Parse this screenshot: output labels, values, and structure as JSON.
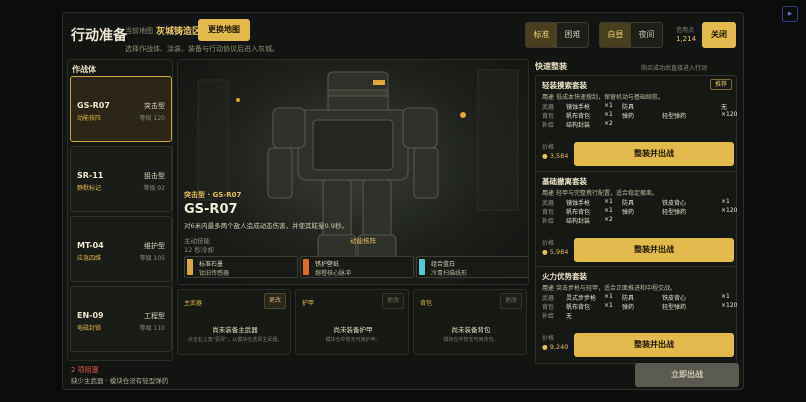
{
  "header": {
    "title": "行动准备",
    "map_label": "当前地图",
    "map_name": "灰城铸造区",
    "change_map": "更换地图",
    "subtitle": "选择作战体、涂装、装备与行动协议后进入灰城。",
    "difficulty": [
      "标准",
      "困难"
    ],
    "time": [
      "白昼",
      "夜间"
    ],
    "credit_label": "信用点",
    "credit_value": "1,214",
    "close": "关闭"
  },
  "left": {
    "title": "作战体",
    "mechs": [
      {
        "id": "GS-R07",
        "role": "突击型",
        "sub": "动能核阵",
        "level": "等级 120"
      },
      {
        "id": "SR-11",
        "role": "狙击型",
        "sub": "静默标记",
        "level": "等级 92"
      },
      {
        "id": "MT-04",
        "role": "维护型",
        "sub": "应急四维",
        "level": "等级 105"
      },
      {
        "id": "EN-09",
        "role": "工程型",
        "sub": "电磁封锁",
        "level": "等级 110"
      }
    ]
  },
  "hero": {
    "tag": "突击型 · GS-R07",
    "id": "GS-R07",
    "desc": "对6米内最多两个敌人造成动态伤害，并使其眩晕0.9秒。",
    "skill_label": "主动技能",
    "skill_cd": "12 秒冷却",
    "skill_name": "动能核阵",
    "mods": [
      {
        "title": "标准石墨",
        "sub": "钛旧传感器",
        "color": "#d6a84a"
      },
      {
        "title": "锈护壁纸",
        "sub": "熔橙核心脉冲",
        "color": "#e06a2a"
      },
      {
        "title": "组合蓝白",
        "sub": "冷青扫描线形",
        "color": "#59c7cf"
      }
    ]
  },
  "slots": [
    {
      "label": "主武器",
      "change": "更改",
      "name": "尚未装备主武器",
      "hint": "点击右上角\"更改\"，从模块仓选择主武器。"
    },
    {
      "label": "护甲",
      "change": "更改",
      "name": "尚未装备护甲",
      "hint": "模块仓中暂无可用护甲。"
    },
    {
      "label": "背包",
      "change": "更改",
      "name": "尚未装备背包",
      "hint": "模块仓中暂无可用背包。"
    }
  ],
  "right": {
    "title": "快速整装",
    "hint": "购买成功后直接进入行动",
    "loadouts": [
      {
        "name": "轻装摸索套装",
        "recommend": "推荐",
        "use_label": "用途",
        "use": "低成本快速搜刮，保留机动与基础续航。",
        "rows": [
          [
            "武器",
            "镜蚀手枪",
            "×1",
            "防具",
            "",
            "无"
          ],
          [
            "背包",
            "帆布背包",
            "×1",
            "弹药",
            "轻型弹药",
            "×120"
          ],
          [
            "补给",
            "结构封装",
            "×2",
            "",
            "",
            ""
          ]
        ],
        "price_label": "价格",
        "price": "3,584",
        "button": "整装并出战"
      },
      {
        "name": "基础撤离套装",
        "recommend": "",
        "use_label": "用途",
        "use": "轻甲与完整携行配置，适合稳定撤离。",
        "rows": [
          [
            "武器",
            "镜蚀手枪",
            "×1",
            "防具",
            "铁皮背心",
            "×1"
          ],
          [
            "背包",
            "帆布背包",
            "×1",
            "弹药",
            "轻型弹药",
            "×120"
          ],
          [
            "补给",
            "结构封装",
            "×2",
            "",
            "",
            ""
          ]
        ],
        "price_label": "价格",
        "price": "5,984",
        "button": "整装并出战"
      },
      {
        "name": "火力优势套装",
        "recommend": "",
        "use_label": "用途",
        "use": "突击步枪与轻甲，适合正面推进和中程交战。",
        "rows": [
          [
            "武器",
            "灵式步步枪",
            "×1",
            "防具",
            "铁皮背心",
            "×1"
          ],
          [
            "背包",
            "帆布背包",
            "×1",
            "弹药",
            "轻型弹药",
            "×120"
          ],
          [
            "补给",
            "无",
            "",
            "",
            "",
            ""
          ]
        ],
        "price_label": "价格",
        "price": "9,240",
        "button": "整装并出战"
      }
    ]
  },
  "footer": {
    "error_title": "2 项阻塞",
    "error_desc": "缺少主武器 · 模块仓没有轻型弹药",
    "deploy": "立即出战"
  }
}
